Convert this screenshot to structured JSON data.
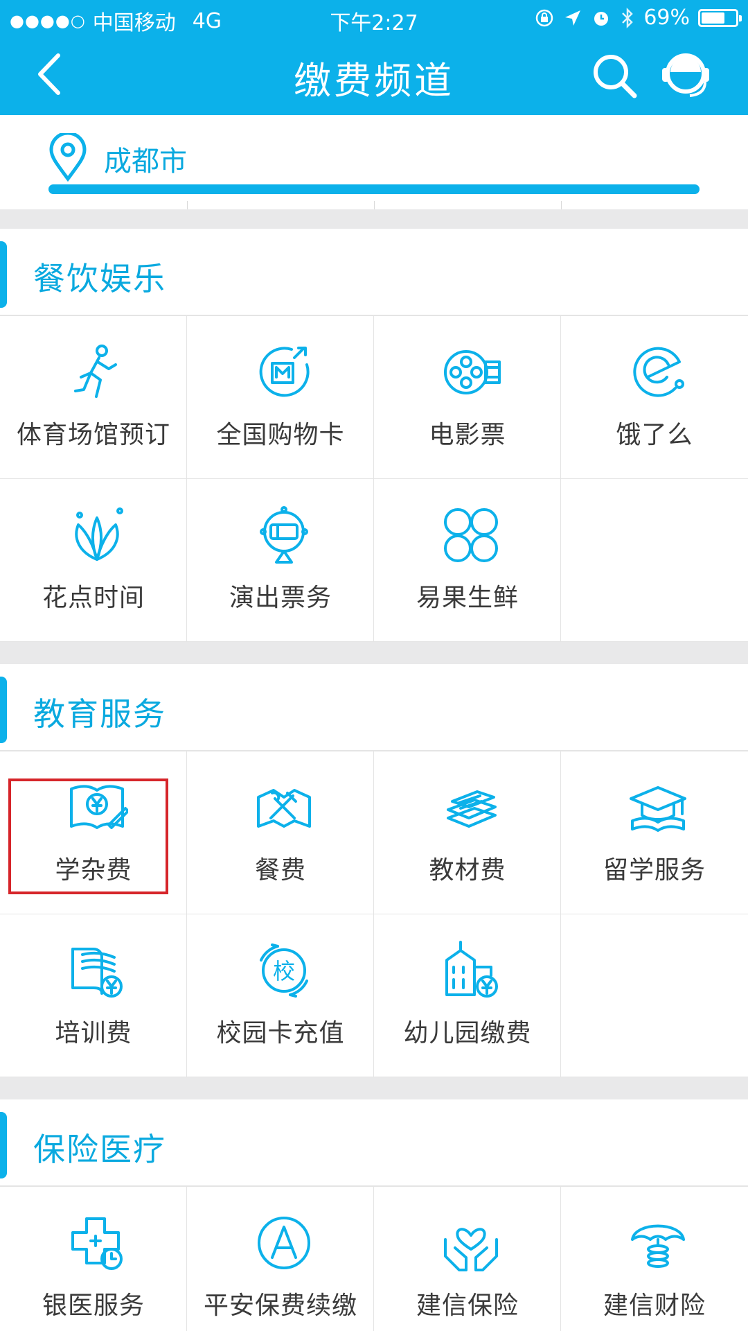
{
  "status_bar": {
    "signal_dots": "●●●●○",
    "carrier": "中国移动",
    "network": "4G",
    "time": "下午2:27",
    "battery_text": "69%",
    "battery_level": 0.69
  },
  "nav": {
    "title": "缴费频道"
  },
  "location": {
    "city": "成都市"
  },
  "sections": [
    {
      "title": "餐饮娱乐",
      "items": [
        {
          "label": "体育场馆预订",
          "icon": "runner-icon"
        },
        {
          "label": "全国购物卡",
          "icon": "shopping-card-icon"
        },
        {
          "label": "电影票",
          "icon": "film-reel-icon"
        },
        {
          "label": "饿了么",
          "icon": "eleme-logo-icon"
        },
        {
          "label": "花点时间",
          "icon": "flower-icon"
        },
        {
          "label": "演出票务",
          "icon": "ticket-badge-icon"
        },
        {
          "label": "易果生鲜",
          "icon": "clover-icon"
        },
        {
          "label": "",
          "icon": ""
        }
      ]
    },
    {
      "title": "教育服务",
      "items": [
        {
          "label": "学杂费",
          "icon": "tuition-book-icon"
        },
        {
          "label": "餐费",
          "icon": "meal-fork-icon"
        },
        {
          "label": "教材费",
          "icon": "textbook-stack-icon"
        },
        {
          "label": "留学服务",
          "icon": "graduation-cap-icon"
        },
        {
          "label": "培训费",
          "icon": "training-book-icon"
        },
        {
          "label": "校园卡充值",
          "icon": "campus-card-icon"
        },
        {
          "label": "幼儿园缴费",
          "icon": "kindergarten-building-icon"
        },
        {
          "label": "",
          "icon": ""
        }
      ]
    },
    {
      "title": "保险医疗",
      "items": [
        {
          "label": "银医服务",
          "icon": "medical-cross-icon"
        },
        {
          "label": "平安保费续缴",
          "icon": "ping-an-a-icon"
        },
        {
          "label": "建信保险",
          "icon": "heart-hands-icon"
        },
        {
          "label": "建信财险",
          "icon": "umbrella-coins-icon"
        }
      ]
    }
  ]
}
